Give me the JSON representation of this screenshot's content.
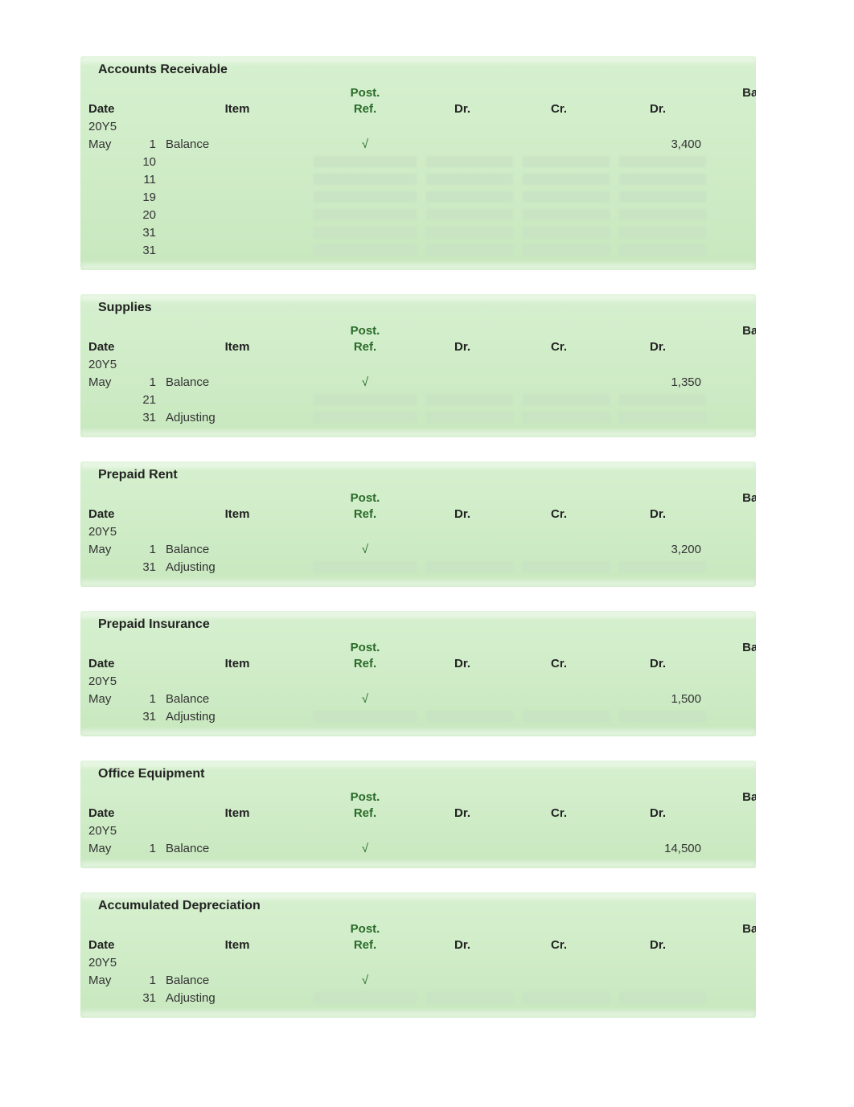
{
  "headers": {
    "date": "Date",
    "item": "Item",
    "post_top": "Post.",
    "post_bot": "Ref.",
    "dr": "Dr.",
    "cr": "Cr.",
    "bal_dr": "Dr.",
    "bal_top": "Balan"
  },
  "year_label": "20Y5",
  "check": "√",
  "ledgers": [
    {
      "title": "Accounts Receivable",
      "rows": [
        {
          "month": "May",
          "day": "1",
          "item": "Balance",
          "post": "√",
          "dr": "",
          "cr": "",
          "baldr": "3,400"
        },
        {
          "month": "",
          "day": "10",
          "item": "",
          "post": "blank",
          "dr": "blank",
          "cr": "blank",
          "baldr": "blank"
        },
        {
          "month": "",
          "day": "11",
          "item": "",
          "post": "blank",
          "dr": "blank",
          "cr": "blank",
          "baldr": "blank"
        },
        {
          "month": "",
          "day": "19",
          "item": "",
          "post": "blank",
          "dr": "blank",
          "cr": "blank",
          "baldr": "blank"
        },
        {
          "month": "",
          "day": "20",
          "item": "",
          "post": "blank",
          "dr": "blank",
          "cr": "blank",
          "baldr": "blank"
        },
        {
          "month": "",
          "day": "31",
          "item": "",
          "post": "blank",
          "dr": "blank",
          "cr": "blank",
          "baldr": "blank"
        },
        {
          "month": "",
          "day": "31",
          "item": "",
          "post": "blank",
          "dr": "blank",
          "cr": "blank",
          "baldr": "blank"
        }
      ]
    },
    {
      "title": "Supplies",
      "rows": [
        {
          "month": "May",
          "day": "1",
          "item": "Balance",
          "post": "√",
          "dr": "",
          "cr": "",
          "baldr": "1,350"
        },
        {
          "month": "",
          "day": "21",
          "item": "",
          "post": "blank",
          "dr": "blank",
          "cr": "blank",
          "baldr": "blank"
        },
        {
          "month": "",
          "day": "31",
          "item": "Adjusting",
          "post": "blank",
          "dr": "blank",
          "cr": "blank",
          "baldr": "blank"
        }
      ]
    },
    {
      "title": "Prepaid Rent",
      "rows": [
        {
          "month": "May",
          "day": "1",
          "item": "Balance",
          "post": "√",
          "dr": "",
          "cr": "",
          "baldr": "3,200"
        },
        {
          "month": "",
          "day": "31",
          "item": "Adjusting",
          "post": "blank",
          "dr": "blank",
          "cr": "blank",
          "baldr": "blank"
        }
      ]
    },
    {
      "title": "Prepaid Insurance",
      "rows": [
        {
          "month": "May",
          "day": "1",
          "item": "Balance",
          "post": "√",
          "dr": "",
          "cr": "",
          "baldr": "1,500"
        },
        {
          "month": "",
          "day": "31",
          "item": "Adjusting",
          "post": "blank",
          "dr": "blank",
          "cr": "blank",
          "baldr": "blank"
        }
      ]
    },
    {
      "title": "Office Equipment",
      "rows": [
        {
          "month": "May",
          "day": "1",
          "item": "Balance",
          "post": "√",
          "dr": "",
          "cr": "",
          "baldr": "14,500"
        }
      ]
    },
    {
      "title": "Accumulated Depreciation",
      "rows": [
        {
          "month": "May",
          "day": "1",
          "item": "Balance",
          "post": "√",
          "dr": "",
          "cr": "",
          "baldr": ""
        },
        {
          "month": "",
          "day": "31",
          "item": "Adjusting",
          "post": "blank",
          "dr": "blank",
          "cr": "blank",
          "baldr": "blank"
        }
      ]
    }
  ]
}
